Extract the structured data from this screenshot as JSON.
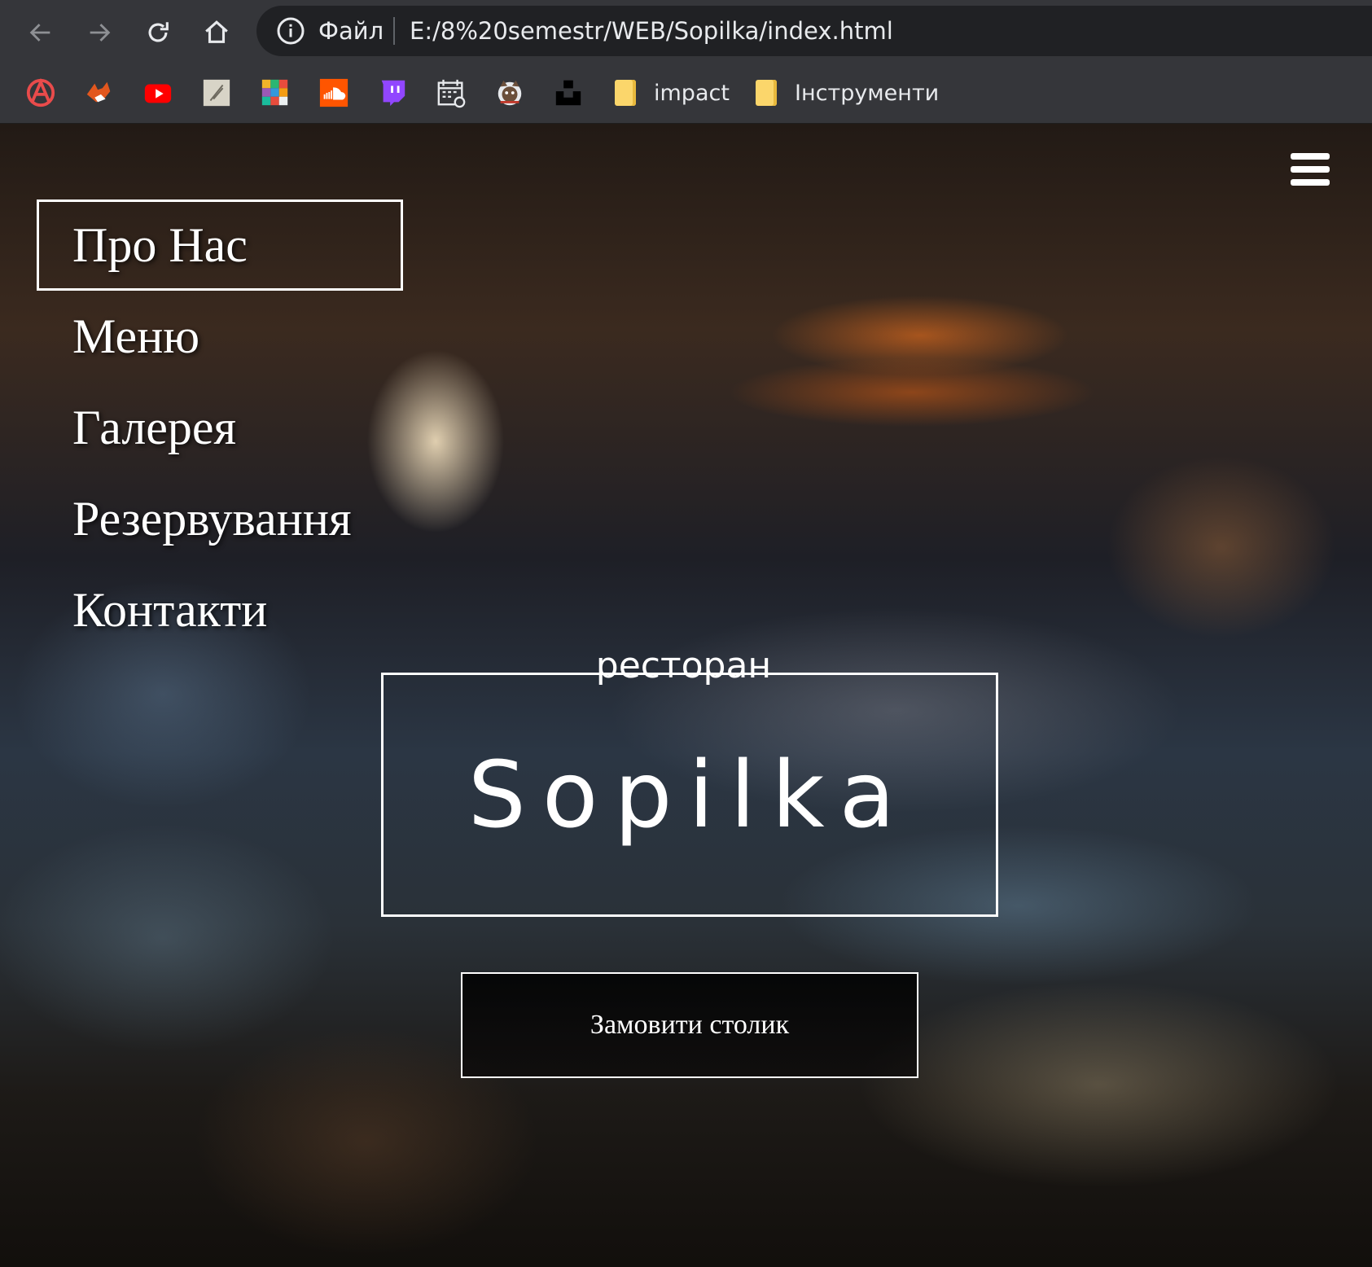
{
  "browser": {
    "back_icon": "arrow-left-icon",
    "forward_icon": "arrow-right-icon",
    "reload_icon": "reload-icon",
    "home_icon": "home-icon",
    "site_info_icon": "info-icon",
    "scheme_label": "Файл",
    "url": "E:/8%20semestr/WEB/Sopilka/index.html",
    "bookmarks": [
      {
        "icon": "anarchy-icon"
      },
      {
        "icon": "fox-icon"
      },
      {
        "icon": "youtube-icon"
      },
      {
        "icon": "sketch-icon"
      },
      {
        "icon": "mosaic-icon"
      },
      {
        "icon": "soundcloud-icon"
      },
      {
        "icon": "twitch-icon"
      },
      {
        "icon": "calendar-icon"
      },
      {
        "icon": "cat-icon"
      },
      {
        "icon": "unsplash-icon"
      }
    ],
    "folders": [
      {
        "label": "impact",
        "icon": "folder-icon"
      },
      {
        "label": "Інструменти",
        "icon": "folder-icon"
      }
    ]
  },
  "page": {
    "menu_icon": "hamburger-menu-icon",
    "nav": [
      {
        "label": "Про Нас",
        "active": true
      },
      {
        "label": "Меню",
        "active": false
      },
      {
        "label": "Галерея",
        "active": false
      },
      {
        "label": "Резервування",
        "active": false
      },
      {
        "label": "Контакти",
        "active": false
      }
    ],
    "hero_kicker": "ресторан",
    "hero_title": "Sopilka",
    "cta_label": "Замовити столик"
  }
}
